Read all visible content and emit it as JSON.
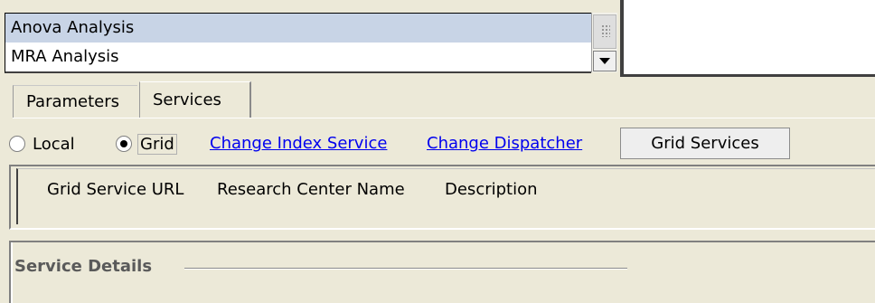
{
  "analysis_list": {
    "items": [
      {
        "label": "Anova Analysis",
        "selected": true
      },
      {
        "label": "MRA Analysis",
        "selected": false
      }
    ]
  },
  "tabs": [
    {
      "label": "Parameters",
      "active": false
    },
    {
      "label": "Services",
      "active": true
    }
  ],
  "services": {
    "radio_local": "Local",
    "radio_grid": "Grid",
    "selected_mode": "Grid",
    "link_change_index": "Change Index Service",
    "link_change_dispatcher": "Change Dispatcher",
    "grid_services_button": "Grid Services"
  },
  "table": {
    "columns": [
      "Grid Service URL",
      "Research Center Name",
      "Description"
    ],
    "rows": []
  },
  "service_details": {
    "title": "Service Details"
  },
  "colors": {
    "panel_bg": "#ece9d8",
    "selection": "#c8d4e6",
    "link": "#0000ee"
  }
}
